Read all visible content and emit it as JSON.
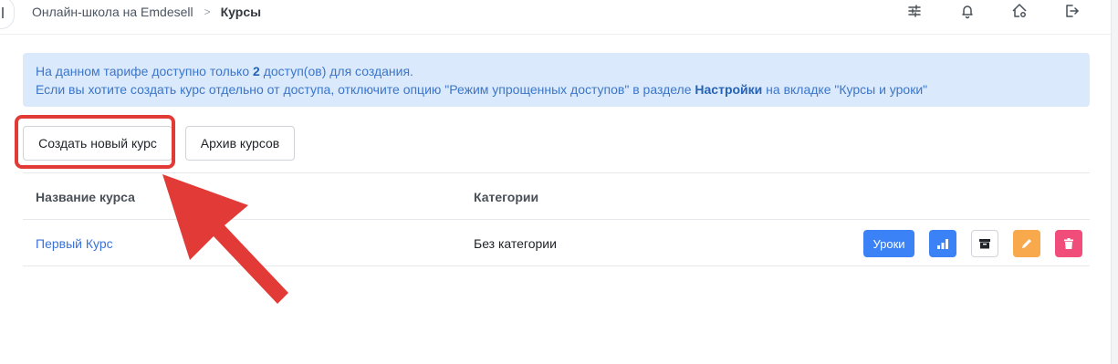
{
  "breadcrumb": {
    "parent": "Онлайн-школа на Emdesell",
    "separator": ">",
    "current": "Курсы"
  },
  "top_icons": [
    "sliders-icon",
    "bell-icon",
    "home-settings-icon",
    "logout-icon"
  ],
  "alert": {
    "line1_prefix": "На данном тарифе доступно только ",
    "line1_count": "2",
    "line1_suffix": " доступ(ов) для создания.",
    "line2_prefix": "Если вы хотите создать курс отдельно от доступа, отключите опцию \"Режим упрощенных доступов\" в разделе ",
    "line2_link": "Настройки",
    "line2_suffix": " на вкладке \"Курсы и уроки\""
  },
  "toolbar": {
    "create_label": "Создать новый курс",
    "archive_label": "Архив курсов"
  },
  "table": {
    "headers": {
      "name": "Название курса",
      "category": "Категории"
    },
    "rows": [
      {
        "name": "Первый Курс",
        "category": "Без категории",
        "lessons_label": "Уроки"
      }
    ]
  },
  "colors": {
    "primary": "#3b82f6",
    "warning": "#f7a94c",
    "danger": "#f14d7a",
    "alert_bg": "#dbe9fc",
    "highlight": "#e23a36"
  }
}
